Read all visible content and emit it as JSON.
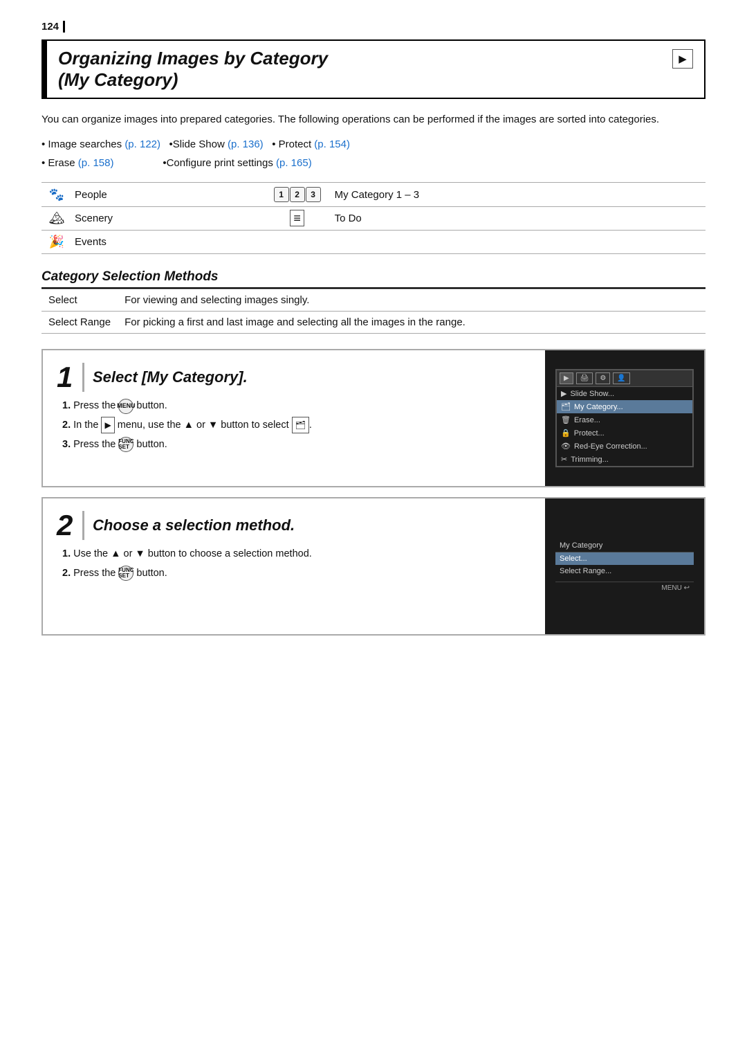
{
  "page": {
    "number": "124",
    "title_line1": "Organizing Images by Category",
    "title_line2": "(My Category)",
    "playback_icon": "▶",
    "intro": {
      "para1": "You can organize images into prepared categories. The following operations can be performed if the images are sorted into categories.",
      "bullets": [
        "• Image searches (p. 122)  •Slide Show (p. 136)  • Protect (p. 154)",
        "• Erase (p. 158)               •Configure print settings (p. 165)"
      ]
    },
    "category_table": {
      "left": [
        {
          "icon": "🐾",
          "label": "People"
        },
        {
          "icon": "🏔",
          "label": "Scenery"
        },
        {
          "icon": "🎉",
          "label": "Events"
        }
      ],
      "right": [
        {
          "icon": "123",
          "label": "My Category 1 – 3"
        },
        {
          "icon": "≡",
          "label": "To Do"
        }
      ]
    },
    "section_title": "Category Selection Methods",
    "methods": [
      {
        "name": "Select",
        "desc": "For viewing and selecting images singly."
      },
      {
        "name": "Select Range",
        "desc": "For picking a first and last image and selecting all the images in the range."
      }
    ],
    "step1": {
      "number": "1",
      "heading": "Select [My Category].",
      "instructions": [
        "1. Press the MENU button.",
        "2. In the ▶ menu, use the ▲ or ▼ button to select 🗂.",
        "3. Press the FUNC/SET button."
      ],
      "screen": {
        "tabs": [
          "▶",
          "🖨",
          "⚙",
          "👤"
        ],
        "rows": [
          {
            "icon": "▶",
            "text": "Slide Show...",
            "highlighted": false
          },
          {
            "icon": "🗂",
            "text": "My Category...",
            "highlighted": true
          },
          {
            "icon": "🗑",
            "text": "Erase...",
            "highlighted": false
          },
          {
            "icon": "🔒",
            "text": "Protect...",
            "highlighted": false
          },
          {
            "icon": "👁",
            "text": "Red-Eye Correction...",
            "highlighted": false
          },
          {
            "icon": "✂",
            "text": "Trimming...",
            "highlighted": false
          }
        ]
      }
    },
    "step2": {
      "number": "2",
      "heading": "Choose a selection method.",
      "instructions": [
        "1. Use the ▲ or ▼ button to choose a selection method.",
        "2. Press the FUNC/SET button."
      ],
      "screen": {
        "title": "My Category",
        "rows": [
          {
            "text": "Select...",
            "selected": true
          },
          {
            "text": "Select Range...",
            "selected": false
          }
        ],
        "bottom": "MENU ↩"
      }
    },
    "links": {
      "p122": "p. 122",
      "p136": "p. 136",
      "p154": "p. 154",
      "p158": "p. 158",
      "p165": "p. 165"
    }
  }
}
